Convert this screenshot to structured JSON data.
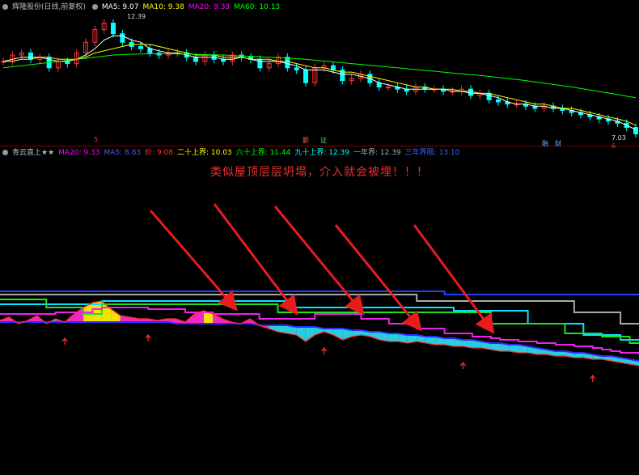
{
  "top_legend": {
    "stock_label": "辉隆股份(日线,前复权)",
    "items": [
      {
        "label": "MA5: 9.07",
        "color": "#ffffff"
      },
      {
        "label": "MA10: 9.38",
        "color": "#ffff00"
      },
      {
        "label": "MA20: 9.33",
        "color": "#ff00ff"
      },
      {
        "label": "MA60: 10.13",
        "color": "#00ff00"
      }
    ]
  },
  "bottom_legend": {
    "indicator_label": "青云直上★★",
    "items": [
      {
        "label": "MA20: 9.33",
        "color": "#ff00ff"
      },
      {
        "label": "MA5: 8.83",
        "color": "#3030ff"
      },
      {
        "label": "价: 9.08",
        "color": "#ff3030"
      },
      {
        "label": "二十上界: 10.03",
        "color": "#ffff00"
      },
      {
        "label": "六十上界: 11.44",
        "color": "#00ff00"
      },
      {
        "label": "九十上界: 12.39",
        "color": "#00ffff"
      },
      {
        "label": "一年界: 12.39",
        "color": "#aaaaaa"
      },
      {
        "label": "三年界限: 13.10",
        "color": "#3050ff"
      }
    ]
  },
  "annotation": "类似屋顶层层坍塌，介入就会被埋！！！",
  "price_labels": {
    "high": "12.39",
    "low": "7.03"
  },
  "markers": {
    "m1": "5",
    "m2": "6",
    "badge1": "影",
    "badge2": "证",
    "badge3": "融",
    "badge4": "财"
  },
  "colors": {
    "up": "#ff3030",
    "down": "#00ffff",
    "background": "#000000"
  },
  "chart_data": [
    {
      "type": "line",
      "title": "辉隆股份(日线,前复权)",
      "ylim": [
        6.8,
        12.8
      ],
      "high_label": 12.39,
      "low_label": 7.03,
      "series": [
        {
          "name": "Price",
          "values": [
            10.6,
            10.9,
            11.0,
            10.7,
            10.8,
            10.3,
            10.6,
            10.5,
            11.0,
            11.5,
            12.1,
            12.4,
            11.9,
            11.5,
            11.3,
            11.2,
            11.0,
            10.9,
            11.0,
            11.0,
            10.8,
            10.6,
            10.9,
            10.7,
            10.6,
            10.9,
            10.8,
            10.7,
            10.3,
            10.5,
            10.8,
            10.3,
            10.2,
            9.6,
            10.3,
            10.4,
            10.2,
            9.7,
            9.8,
            10.0,
            9.6,
            9.4,
            9.4,
            9.3,
            9.2,
            9.4,
            9.3,
            9.3,
            9.2,
            9.2,
            9.3,
            9.0,
            9.1,
            8.8,
            8.7,
            8.6,
            8.6,
            8.5,
            8.4,
            8.5,
            8.4,
            8.3,
            8.2,
            8.1,
            8.0,
            7.9,
            7.8,
            7.7,
            7.5,
            7.2
          ]
        },
        {
          "name": "MA5",
          "values": [
            10.6,
            10.7,
            10.8,
            10.8,
            10.8,
            10.7,
            10.6,
            10.6,
            10.7,
            10.9,
            11.2,
            11.6,
            11.8,
            11.8,
            11.6,
            11.5,
            11.2,
            11.1,
            11.0,
            11.0,
            10.9,
            10.8,
            10.8,
            10.8,
            10.7,
            10.7,
            10.8,
            10.7,
            10.6,
            10.6,
            10.6,
            10.5,
            10.4,
            10.2,
            10.2,
            10.2,
            10.1,
            10.0,
            10.0,
            9.9,
            9.8,
            9.6,
            9.5,
            9.4,
            9.3,
            9.3,
            9.3,
            9.3,
            9.3,
            9.2,
            9.2,
            9.1,
            9.1,
            9.0,
            8.9,
            8.7,
            8.6,
            8.6,
            8.5,
            8.5,
            8.4,
            8.4,
            8.3,
            8.2,
            8.1,
            8.0,
            7.9,
            7.8,
            7.6,
            7.4
          ]
        },
        {
          "name": "MA10",
          "values": [
            10.6,
            10.6,
            10.7,
            10.7,
            10.8,
            10.8,
            10.7,
            10.7,
            10.7,
            10.8,
            11.0,
            11.1,
            11.2,
            11.3,
            11.4,
            11.4,
            11.4,
            11.3,
            11.2,
            11.1,
            11.0,
            10.9,
            10.9,
            10.9,
            10.8,
            10.8,
            10.8,
            10.7,
            10.7,
            10.7,
            10.6,
            10.6,
            10.5,
            10.4,
            10.3,
            10.3,
            10.2,
            10.1,
            10.1,
            10.0,
            9.9,
            9.8,
            9.7,
            9.6,
            9.5,
            9.4,
            9.4,
            9.3,
            9.3,
            9.3,
            9.2,
            9.2,
            9.1,
            9.1,
            9.0,
            8.9,
            8.8,
            8.7,
            8.6,
            8.6,
            8.5,
            8.4,
            8.4,
            8.3,
            8.2,
            8.1,
            8.0,
            7.9,
            7.8,
            7.6
          ]
        },
        {
          "name": "MA60",
          "values": [
            10.3,
            10.35,
            10.4,
            10.45,
            10.5,
            10.55,
            10.6,
            10.65,
            10.7,
            10.75,
            10.8,
            10.85,
            10.9,
            10.92,
            10.94,
            10.95,
            10.96,
            10.96,
            10.96,
            10.95,
            10.94,
            10.93,
            10.92,
            10.91,
            10.9,
            10.88,
            10.86,
            10.84,
            10.82,
            10.8,
            10.78,
            10.76,
            10.73,
            10.7,
            10.66,
            10.62,
            10.58,
            10.54,
            10.5,
            10.46,
            10.42,
            10.38,
            10.34,
            10.3,
            10.26,
            10.22,
            10.18,
            10.14,
            10.1,
            10.06,
            10.02,
            9.98,
            9.94,
            9.9,
            9.85,
            9.8,
            9.75,
            9.7,
            9.64,
            9.58,
            9.52,
            9.46,
            9.4,
            9.33,
            9.26,
            9.19,
            9.12,
            9.05,
            8.97,
            8.9
          ]
        }
      ]
    },
    {
      "type": "line",
      "title": "青云直上★★",
      "ylim": [
        5.0,
        14.0
      ],
      "series": [
        {
          "name": "三年界限",
          "values": [
            13.0,
            13.0,
            13.0,
            13.0,
            13.0,
            13.0,
            13.0,
            13.0,
            13.0,
            13.0,
            13.0,
            13.0,
            13.0,
            13.0,
            13.0,
            13.0,
            13.0,
            13.0,
            13.0,
            13.0,
            13.0,
            13.0,
            13.0,
            13.0,
            13.0,
            13.0,
            13.0,
            13.0,
            13.0,
            13.0,
            13.0,
            13.0,
            13.0,
            13.0,
            13.0,
            13.0,
            13.0,
            13.0,
            13.0,
            13.0,
            13.0,
            13.0,
            13.0,
            13.0,
            13.0,
            13.0,
            13.0,
            13.0,
            12.8,
            12.8,
            12.8,
            12.8,
            12.8,
            12.8,
            12.8,
            12.8,
            12.8,
            12.8,
            12.8,
            12.8,
            12.8,
            12.8,
            12.8,
            12.8,
            12.8,
            12.8,
            12.8,
            12.8,
            12.8,
            12.8
          ]
        },
        {
          "name": "一年界",
          "values": [
            12.8,
            12.8,
            12.8,
            12.8,
            12.8,
            12.8,
            12.8,
            12.8,
            12.8,
            12.8,
            12.8,
            12.8,
            12.8,
            12.8,
            12.8,
            12.8,
            12.8,
            12.8,
            12.8,
            12.8,
            12.8,
            12.8,
            12.8,
            12.8,
            12.8,
            12.8,
            12.8,
            12.8,
            12.8,
            12.8,
            12.8,
            12.8,
            12.8,
            12.8,
            12.8,
            12.8,
            12.8,
            12.8,
            12.8,
            12.8,
            12.8,
            12.8,
            12.8,
            12.8,
            12.8,
            12.4,
            12.4,
            12.4,
            12.4,
            12.4,
            12.4,
            12.4,
            12.4,
            12.4,
            12.4,
            12.4,
            12.4,
            12.4,
            12.4,
            12.4,
            12.4,
            12.4,
            11.7,
            11.7,
            11.7,
            11.7,
            11.7,
            11.0,
            11.0,
            11.0
          ]
        },
        {
          "name": "九十上界",
          "values": [
            12.2,
            12.2,
            12.2,
            12.2,
            12.2,
            12.2,
            12.2,
            12.2,
            12.2,
            12.2,
            12.2,
            12.4,
            12.4,
            12.4,
            12.4,
            12.4,
            12.4,
            12.4,
            12.4,
            12.4,
            12.4,
            12.4,
            12.4,
            12.4,
            12.4,
            12.4,
            12.4,
            12.4,
            12.4,
            12.4,
            12.4,
            12.0,
            12.0,
            12.0,
            12.0,
            12.0,
            12.0,
            12.0,
            12.0,
            12.0,
            12.0,
            12.0,
            12.0,
            12.0,
            12.0,
            12.0,
            12.0,
            12.0,
            12.0,
            11.8,
            11.8,
            11.8,
            11.8,
            11.8,
            11.8,
            11.8,
            11.8,
            11.0,
            11.0,
            11.0,
            11.0,
            11.0,
            11.0,
            10.3,
            10.3,
            10.3,
            10.3,
            10.0,
            10.0,
            10.0
          ]
        },
        {
          "name": "六十上界",
          "values": [
            12.5,
            12.5,
            12.5,
            12.5,
            12.5,
            12.0,
            12.0,
            12.0,
            12.0,
            11.6,
            11.6,
            12.2,
            12.2,
            12.2,
            12.2,
            12.2,
            12.2,
            12.2,
            12.2,
            12.2,
            12.2,
            12.2,
            12.2,
            12.2,
            12.2,
            12.2,
            12.2,
            12.2,
            12.2,
            12.2,
            11.7,
            11.7,
            11.7,
            11.7,
            11.7,
            11.7,
            11.7,
            11.7,
            11.7,
            11.7,
            11.7,
            11.7,
            11.7,
            11.7,
            11.7,
            11.7,
            11.7,
            11.7,
            11.7,
            11.7,
            11.7,
            11.7,
            11.7,
            11.0,
            11.0,
            11.0,
            11.0,
            11.0,
            11.0,
            11.0,
            11.0,
            10.4,
            10.4,
            10.4,
            10.4,
            10.2,
            10.2,
            10.2,
            9.8,
            9.8
          ]
        },
        {
          "name": "MA20",
          "values": [
            11.6,
            11.6,
            11.6,
            11.6,
            11.6,
            11.6,
            11.7,
            11.7,
            11.7,
            11.7,
            11.9,
            12.0,
            12.0,
            12.0,
            12.0,
            12.0,
            11.9,
            11.9,
            11.9,
            11.9,
            11.7,
            11.7,
            11.7,
            11.6,
            11.6,
            11.6,
            11.6,
            11.6,
            11.3,
            11.3,
            11.3,
            11.3,
            11.3,
            11.3,
            11.6,
            11.6,
            11.6,
            11.6,
            11.6,
            11.3,
            11.3,
            11.3,
            11.0,
            11.0,
            11.0,
            10.7,
            10.7,
            10.7,
            10.4,
            10.4,
            10.4,
            10.2,
            10.2,
            10.1,
            10.0,
            10.0,
            9.9,
            9.9,
            9.8,
            9.8,
            9.7,
            9.7,
            9.6,
            9.6,
            9.5,
            9.4,
            9.3,
            9.2,
            9.2,
            9.1
          ]
        },
        {
          "name": "MA5",
          "values": [
            11.1,
            11.1,
            11.1,
            11.1,
            11.1,
            11.1,
            11.1,
            11.1,
            11.1,
            11.1,
            11.1,
            11.1,
            11.1,
            11.1,
            11.1,
            11.1,
            11.1,
            11.1,
            11.1,
            11.0,
            11.0,
            11.0,
            11.0,
            11.0,
            11.0,
            11.0,
            11.0,
            11.0,
            10.9,
            10.9,
            10.9,
            10.9,
            10.8,
            10.8,
            10.8,
            10.7,
            10.7,
            10.7,
            10.6,
            10.6,
            10.5,
            10.5,
            10.4,
            10.4,
            10.3,
            10.3,
            10.2,
            10.2,
            10.1,
            10.1,
            10.0,
            10.0,
            9.9,
            9.8,
            9.8,
            9.7,
            9.7,
            9.6,
            9.5,
            9.4,
            9.3,
            9.3,
            9.2,
            9.2,
            9.1,
            9.0,
            9.0,
            8.9,
            8.8,
            8.7
          ]
        },
        {
          "name": "价",
          "values": [
            11.2,
            11.4,
            11.0,
            11.2,
            11.5,
            11.0,
            11.3,
            11.1,
            11.6,
            12.0,
            12.3,
            12.4,
            11.9,
            11.5,
            11.4,
            11.3,
            11.3,
            11.2,
            11.3,
            11.3,
            11.1,
            11.6,
            11.8,
            11.6,
            11.3,
            11.1,
            11.0,
            11.3,
            10.9,
            10.7,
            10.5,
            10.4,
            10.3,
            9.9,
            10.3,
            10.5,
            10.3,
            10.0,
            10.2,
            10.3,
            10.2,
            10.0,
            9.9,
            9.9,
            9.8,
            9.9,
            9.8,
            9.7,
            9.7,
            9.6,
            9.6,
            9.5,
            9.5,
            9.4,
            9.3,
            9.3,
            9.2,
            9.2,
            9.1,
            9.1,
            9.0,
            9.0,
            8.9,
            8.9,
            8.8,
            8.8,
            8.7,
            8.6,
            8.5,
            8.4
          ]
        }
      ]
    }
  ]
}
